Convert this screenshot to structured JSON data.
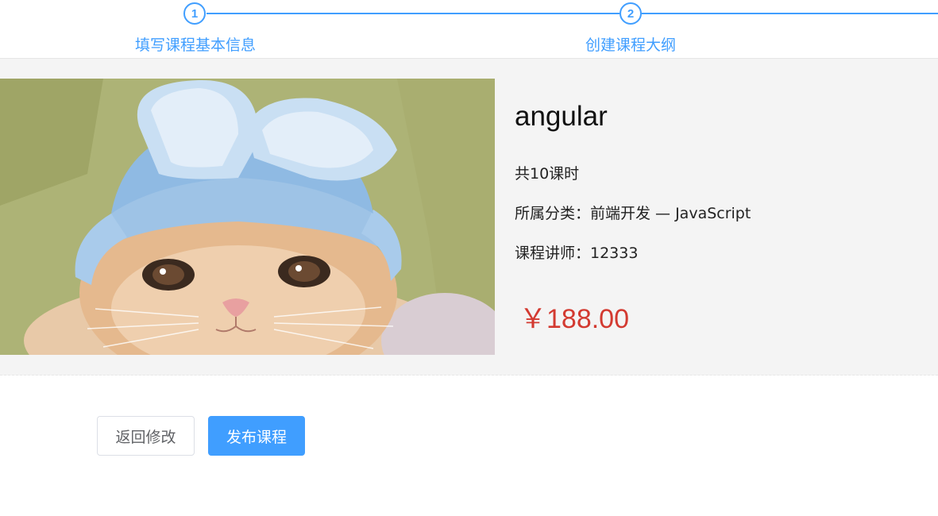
{
  "steps": [
    {
      "number": "1",
      "title": "填写课程基本信息"
    },
    {
      "number": "2",
      "title": "创建课程大纲"
    }
  ],
  "course": {
    "cover_alt": "cat wearing blue bunny-ear hat",
    "title": "angular",
    "lessons": "共10课时",
    "category": "所属分类：前端开发 — JavaScript",
    "teacher": "课程讲师：12333",
    "price": "￥188.00"
  },
  "actions": {
    "back_label": "返回修改",
    "publish_label": "发布课程"
  },
  "colors": {
    "accent": "#409eff",
    "price": "#d33a31",
    "panel_bg": "#f4f4f4"
  }
}
